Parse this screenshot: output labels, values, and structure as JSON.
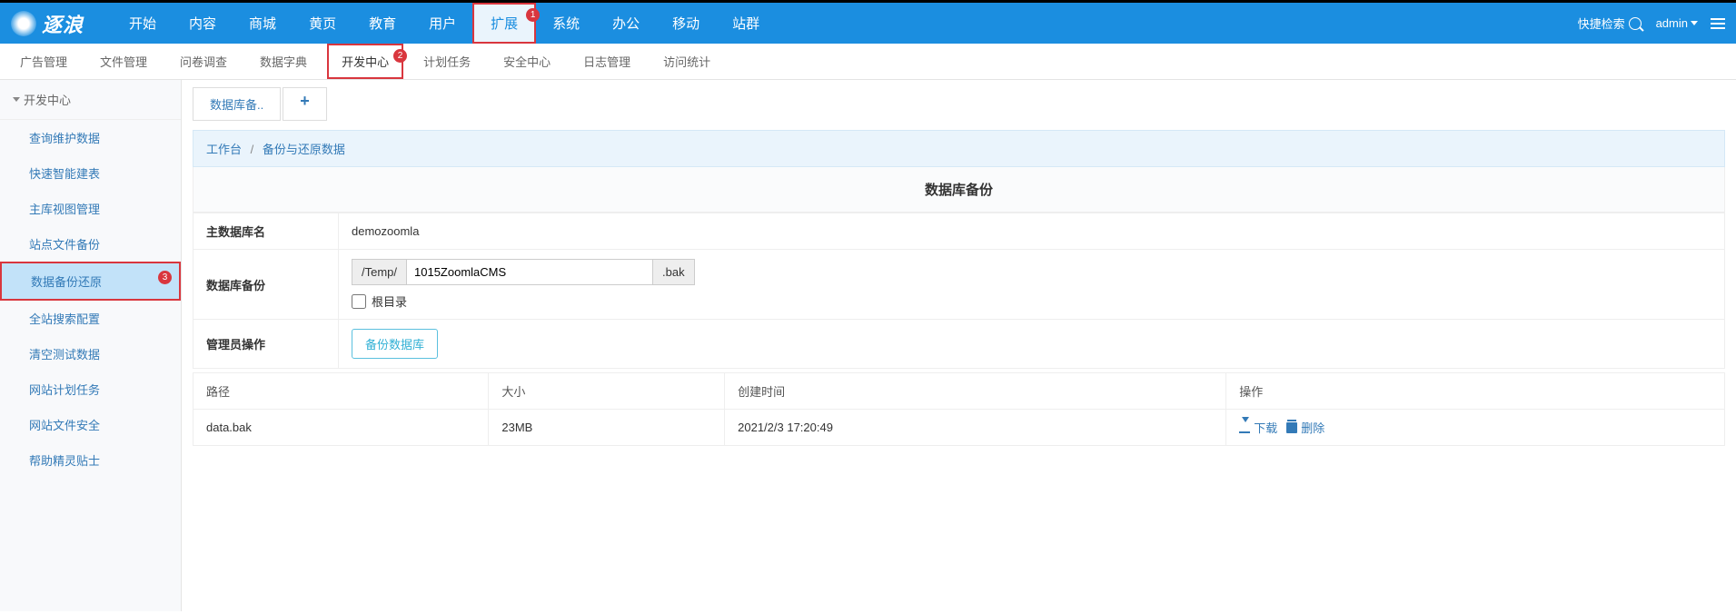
{
  "header": {
    "logo_text": "逐浪",
    "nav": [
      "开始",
      "内容",
      "商城",
      "黄页",
      "教育",
      "用户",
      "扩展",
      "系统",
      "办公",
      "移动",
      "站群"
    ],
    "nav_highlight_index": 6,
    "nav_badge_index": 6,
    "nav_badge_text": "1",
    "quick_search_label": "快捷检索",
    "admin_label": "admin"
  },
  "subnav": {
    "items": [
      "广告管理",
      "文件管理",
      "问卷调查",
      "数据字典",
      "开发中心",
      "计划任务",
      "安全中心",
      "日志管理",
      "访问统计"
    ],
    "highlight_index": 4,
    "badge_index": 4,
    "badge_text": "2"
  },
  "sidebar": {
    "head": "开发中心",
    "items": [
      "查询维护数据",
      "快速智能建表",
      "主库视图管理",
      "站点文件备份",
      "数据备份还原",
      "全站搜索配置",
      "清空测试数据",
      "网站计划任务",
      "网站文件安全",
      "帮助精灵贴士"
    ],
    "active_index": 4,
    "highlight_index": 4,
    "badge_text": "3"
  },
  "tabs": {
    "items": [
      "数据库备.."
    ]
  },
  "breadcrumb": {
    "items": [
      "工作台",
      "备份与还原数据"
    ]
  },
  "panel": {
    "title": "数据库备份"
  },
  "form": {
    "rows": {
      "db_name_label": "主数据库名",
      "db_name_value": "demozoomla",
      "backup_label": "数据库备份",
      "prefix": "/Temp/",
      "filename_value": "1015ZoomlaCMS",
      "suffix": ".bak",
      "root_checkbox_label": "根目录",
      "admin_op_label": "管理员操作",
      "backup_button": "备份数据库"
    }
  },
  "table": {
    "headers": [
      "路径",
      "大小",
      "创建时间",
      "操作"
    ],
    "rows": [
      {
        "path": "data.bak",
        "size": "23MB",
        "created": "2021/2/3 17:20:49",
        "download": "下载",
        "delete": "删除"
      }
    ]
  }
}
